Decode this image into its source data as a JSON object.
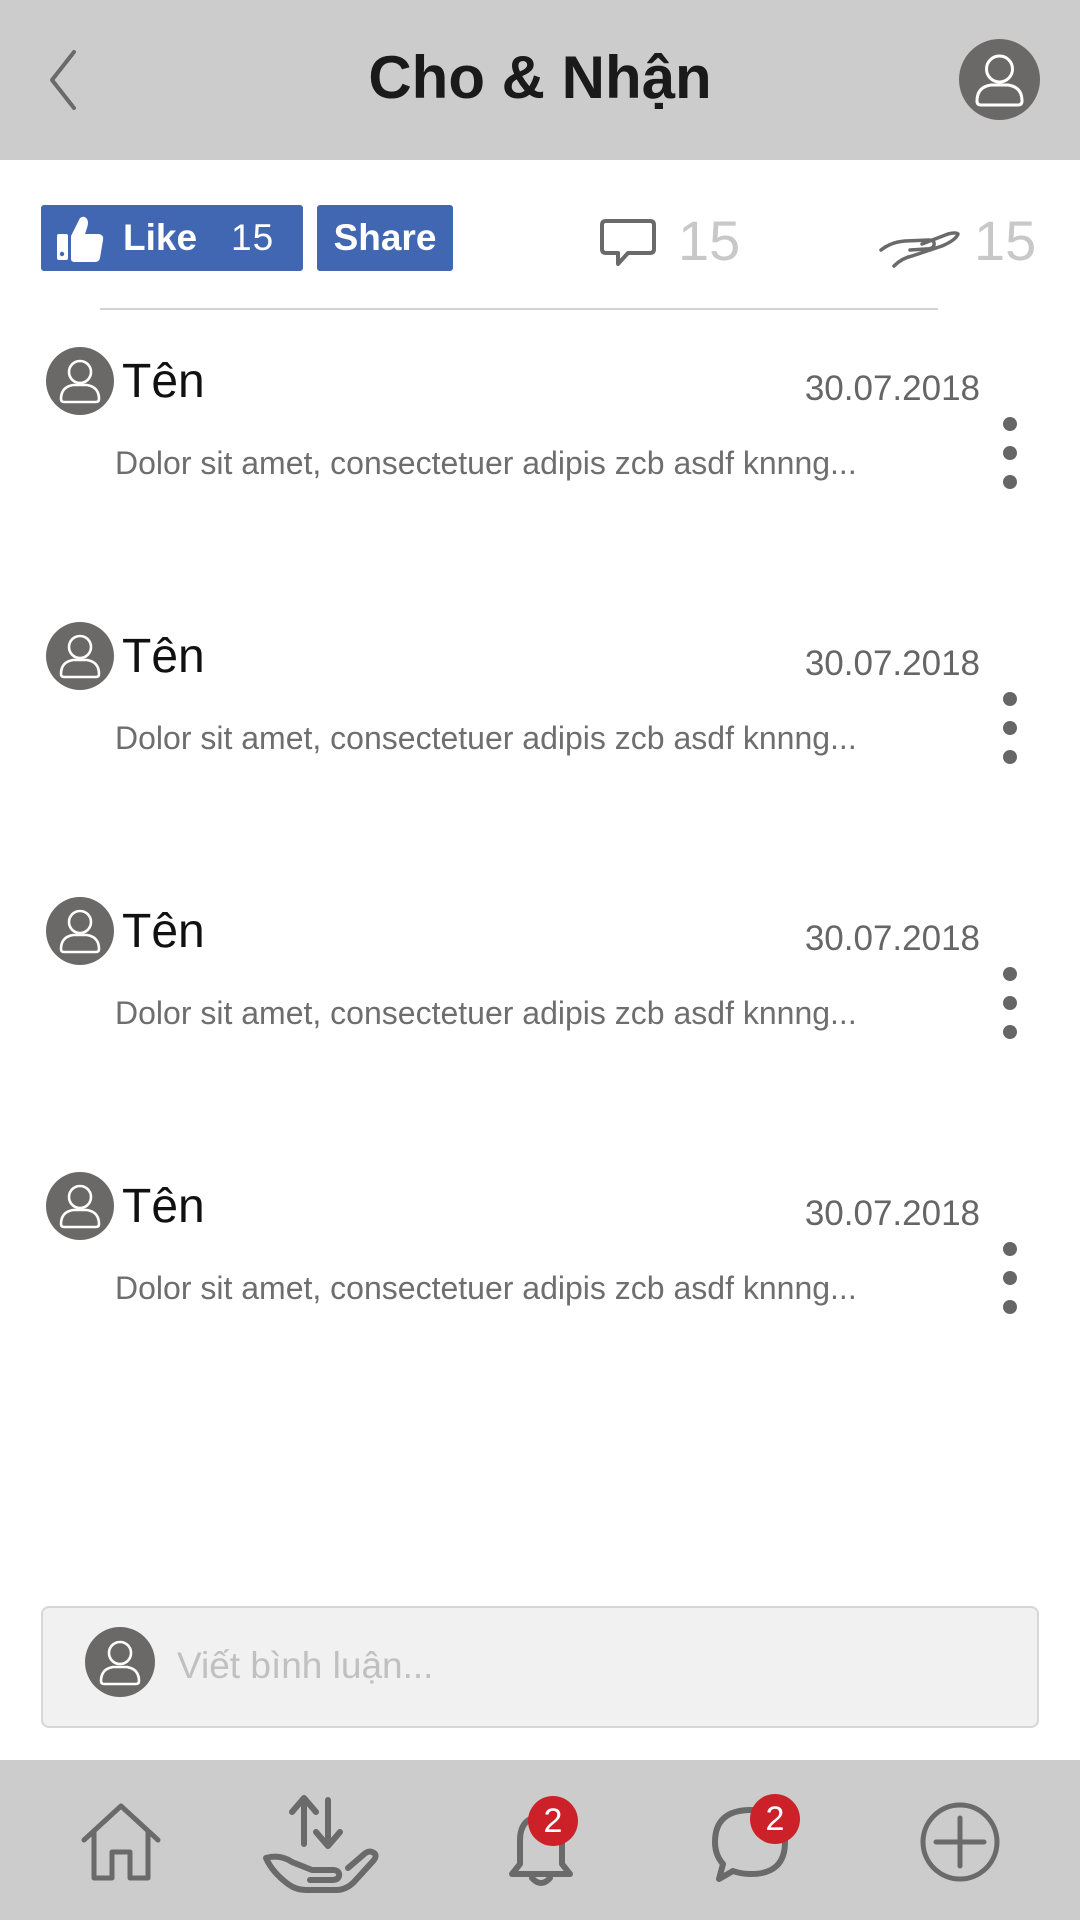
{
  "header": {
    "title": "Cho & Nhận",
    "back_icon": "chevron-left-icon",
    "avatar_icon": "user-icon"
  },
  "actions": {
    "like_label": "Like",
    "like_count": "15",
    "share_label": "Share",
    "comment_count": "15",
    "give_count": "15",
    "brand_color": "#4267b2"
  },
  "comments": [
    {
      "name": "Tên",
      "date": "30.07.2018",
      "text": "Dolor sit amet, consectetuer adipis zcb asdf knnng..."
    },
    {
      "name": "Tên",
      "date": "30.07.2018",
      "text": "Dolor sit amet, consectetuer adipis zcb asdf knnng..."
    },
    {
      "name": "Tên",
      "date": "30.07.2018",
      "text": "Dolor sit amet, consectetuer adipis zcb asdf knnng..."
    },
    {
      "name": "Tên",
      "date": "30.07.2018",
      "text": "Dolor sit amet, consectetuer adipis zcb asdf knnng..."
    }
  ],
  "comment_input": {
    "placeholder": "Viết bình luận...",
    "value": ""
  },
  "bottom_nav": {
    "items": [
      {
        "icon": "home-icon"
      },
      {
        "icon": "exchange-hand-icon"
      },
      {
        "icon": "bell-icon",
        "badge": "2"
      },
      {
        "icon": "chat-icon",
        "badge": "2"
      },
      {
        "icon": "plus-circle-icon"
      }
    ],
    "badge_color": "#cc2128"
  }
}
